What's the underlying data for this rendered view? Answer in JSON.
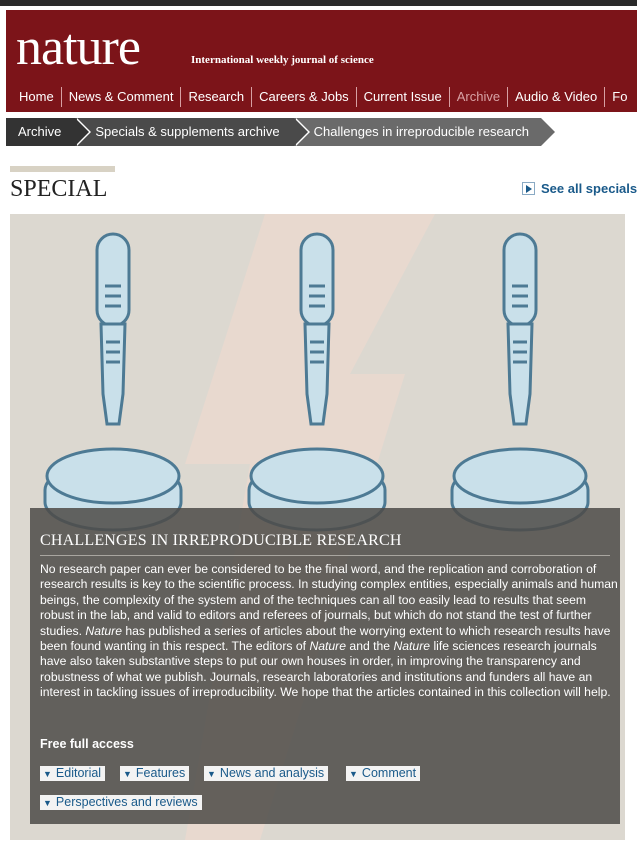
{
  "masthead": {
    "logo": "nature",
    "tagline": "International weekly journal of science"
  },
  "nav": {
    "items": [
      {
        "label": "Home"
      },
      {
        "label": "News & Comment"
      },
      {
        "label": "Research"
      },
      {
        "label": "Careers & Jobs"
      },
      {
        "label": "Current Issue"
      },
      {
        "label": "Archive",
        "active": true
      },
      {
        "label": "Audio & Video"
      },
      {
        "label": "Fo"
      }
    ]
  },
  "breadcrumb": [
    {
      "label": "Archive"
    },
    {
      "label": "Specials & supplements archive"
    },
    {
      "label": "Challenges in irreproducible research"
    }
  ],
  "page": {
    "heading": "SPECIAL",
    "see_all": "See all specials"
  },
  "feature": {
    "title": "CHALLENGES IN IRREPRODUCIBLE RESEARCH",
    "body_1": "No research paper can ever be considered to be the final word, and the replication and corroboration of research results is key to the scientific process. In studying complex entities, especially animals and human beings, the complexity of the system and of the techniques can all too easily lead to results that seem robust in the lab, and valid to editors and referees of journals, but which do not stand the test of further studies. ",
    "body_nature_1": "Nature",
    "body_2": " has published a series of articles about the worrying extent to which research results have been found wanting in this respect. The editors of ",
    "body_nature_2": "Nature",
    "body_3": " and the ",
    "body_nature_3": "Nature",
    "body_4": " life sciences research journals have also taken substantive steps to put our own houses in order, in improving the transparency and robustness of what we publish. Journals, research laboratories and institutions and funders all have an interest in tackling issues of irreproducibility. We hope that the articles contained in this collection will help.",
    "access_label": "Free full access",
    "tags": [
      {
        "label": "Editorial"
      },
      {
        "label": "Features"
      },
      {
        "label": "News and analysis"
      },
      {
        "label": "Comment"
      },
      {
        "label": "Perspectives and reviews"
      }
    ]
  },
  "colors": {
    "brand": "#7c1419",
    "link": "#1a5a8a",
    "panel": "#4e4c48"
  },
  "icons": {
    "tag_arrow": "▼"
  }
}
